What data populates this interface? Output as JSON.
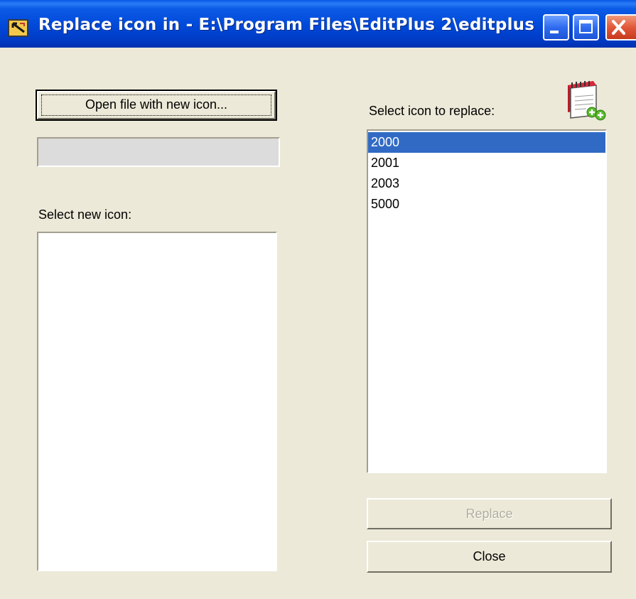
{
  "window": {
    "title": "Replace icon in - E:\\Program Files\\EditPlus 2\\editplus....",
    "accent_color": "#0048d8",
    "close_color": "#e2583a"
  },
  "left": {
    "open_button_label": "Open file with new icon...",
    "file_path_value": "",
    "select_new_icon_label": "Select new icon:",
    "new_icon_items": []
  },
  "right": {
    "select_icon_label": "Select icon to replace:",
    "app_icon": "notebook-add-icon",
    "icon_items": [
      "2000",
      "2001",
      "2003",
      "5000"
    ],
    "selected_index": 0,
    "replace_button_label": "Replace",
    "replace_disabled": true,
    "close_button_label": "Close"
  },
  "selection_color": "#316ac5"
}
